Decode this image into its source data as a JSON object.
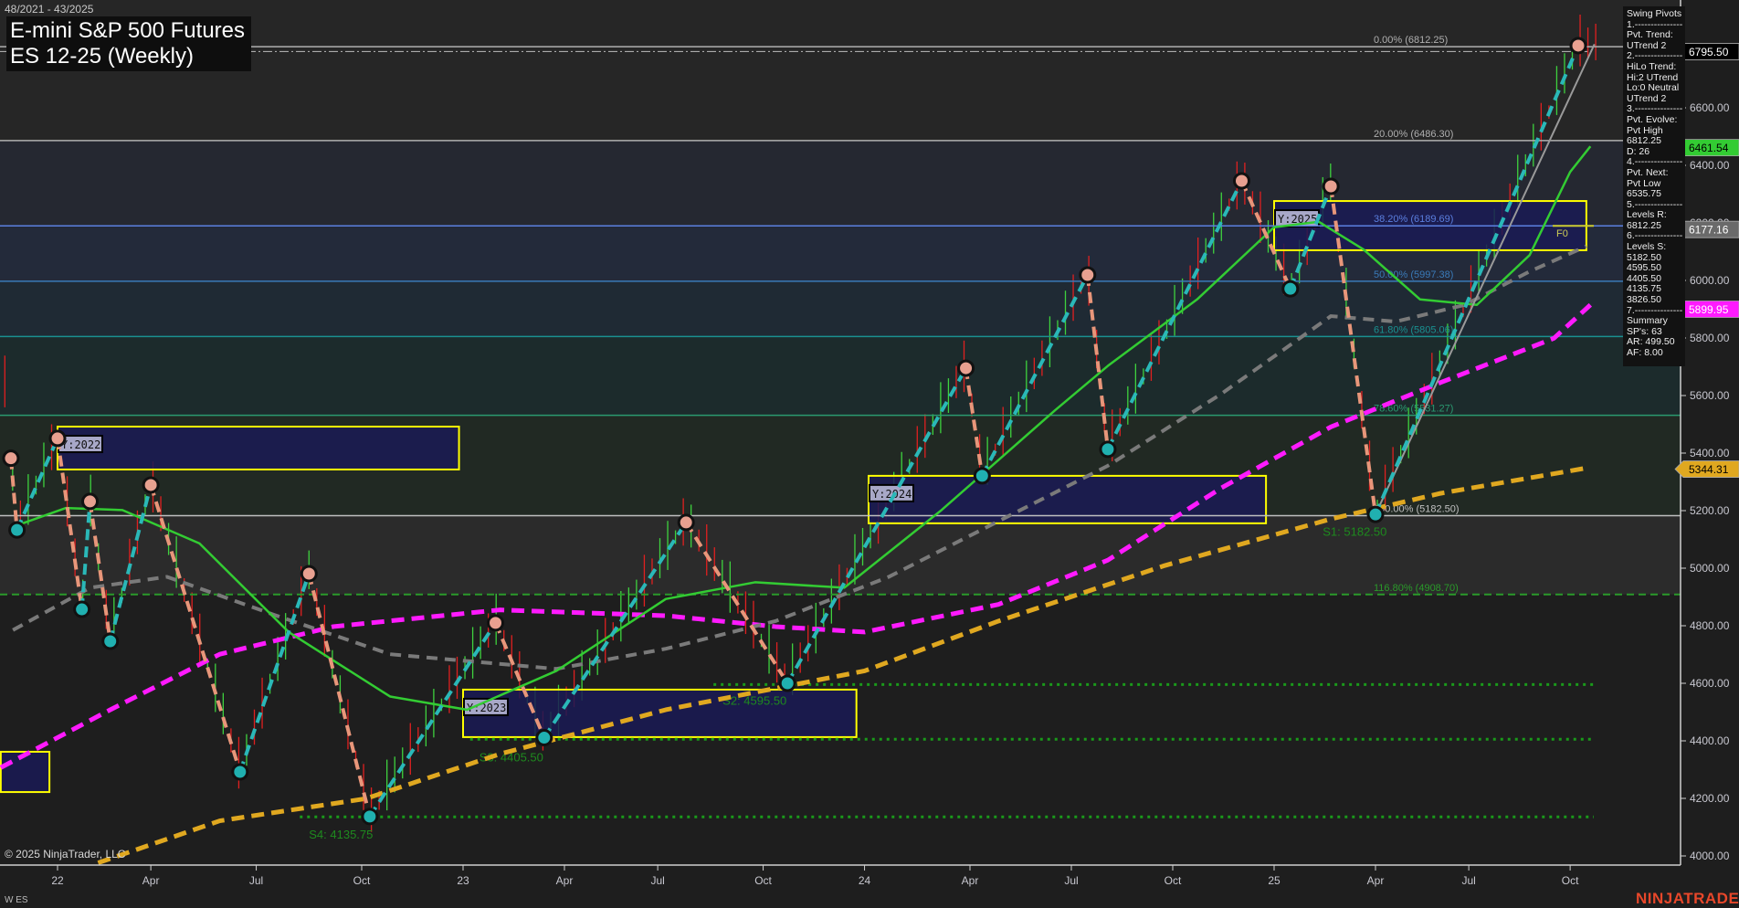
{
  "header": {
    "date_range": "48/2021 - 43/2025",
    "title": "E-mini S&P 500 Futures",
    "subtitle": "ES 12-25 (Weekly)"
  },
  "info_panel": {
    "lines": [
      "Swing Pivots",
      "1.---------------",
      "Pvt. Trend:",
      "UTrend 2",
      "2.---------------",
      "HiLo Trend:",
      "Hi:2 UTrend",
      "Lo:0 Neutral",
      "UTrend 2",
      "3.---------------",
      "Pvt. Evolve:",
      "Pvt High",
      "6812.25",
      "D: 26",
      "4.---------------",
      "Pvt. Next:",
      "Pvt Low",
      "6535.75",
      "5.---------------",
      "Levels R:",
      "6812.25",
      "6.---------------",
      "Levels S:",
      "5182.50",
      "4595.50",
      "4405.50",
      "4135.75",
      "3826.50",
      "7.---------------",
      "Summary",
      "SP's: 63",
      "AR: 499.50",
      "AF: 8.00"
    ]
  },
  "footer": {
    "copyright": "© 2025 NinjaTrader, LLC",
    "instrument_tag": "W ES",
    "brand": "NINJATRADER"
  },
  "colors": {
    "up_swing": "#2ab8b8",
    "down_swing": "#e8967a",
    "ma_green": "#33cc33",
    "ma_gray": "#7a7a7a",
    "ma_magenta": "#ff1aff",
    "ma_orange": "#e0a820",
    "zone_fill": "#1a1a55",
    "zone_border": "#ffff00",
    "brand": "#e8472a"
  },
  "chart_data": {
    "type": "line",
    "title": "E-mini S&P 500 Futures ES 12-25 (Weekly)",
    "xlabel": "",
    "ylabel": "",
    "ylim": [
      4000,
      6900
    ],
    "x_ticks": [
      {
        "label": "22",
        "x": 2022.0
      },
      {
        "label": "Apr",
        "x": 2022.23
      },
      {
        "label": "Jul",
        "x": 2022.49
      },
      {
        "label": "Oct",
        "x": 2022.75
      },
      {
        "label": "23",
        "x": 2023.0
      },
      {
        "label": "Apr",
        "x": 2023.25
      },
      {
        "label": "Jul",
        "x": 2023.48
      },
      {
        "label": "Oct",
        "x": 2023.74
      },
      {
        "label": "24",
        "x": 2023.99
      },
      {
        "label": "Apr",
        "x": 2024.25
      },
      {
        "label": "Jul",
        "x": 2024.5
      },
      {
        "label": "Oct",
        "x": 2024.75
      },
      {
        "label": "25",
        "x": 2025.0
      },
      {
        "label": "Apr",
        "x": 2025.25
      },
      {
        "label": "Jul",
        "x": 2025.48
      },
      {
        "label": "Oct",
        "x": 2025.73
      }
    ],
    "y_ticks": [
      "4000.00",
      "4200.00",
      "4400.00",
      "4600.00",
      "4800.00",
      "5000.00",
      "5200.00",
      "5400.00",
      "5600.00",
      "5800.00",
      "6000.00",
      "6200.00",
      "6400.00",
      "6600.00"
    ],
    "y_tick_values": [
      4000,
      4200,
      4400,
      4600,
      4800,
      5000,
      5200,
      5400,
      5600,
      5800,
      6000,
      6200,
      6400,
      6600
    ],
    "price_tags": [
      {
        "label": "6795.50",
        "value": 6795.5,
        "bg": "#000000",
        "fg": "#ffffff"
      },
      {
        "label": "6461.54",
        "value": 6461.54,
        "bg": "#33cc33",
        "fg": "#000000"
      },
      {
        "label": "6177.16",
        "value": 6177.16,
        "bg": "#6a6a6a",
        "fg": "#ffffff"
      },
      {
        "label": "5899.95",
        "value": 5899.95,
        "bg": "#ff1aff",
        "fg": "#ffffff"
      },
      {
        "label": "5344.31",
        "value": 5344.31,
        "bg": "#e0a820",
        "fg": "#000000"
      }
    ],
    "fib_levels": [
      {
        "label": "0.00% (6812.25)",
        "value": 6812.25,
        "color": "#b0b0b0"
      },
      {
        "label": "20.00% (6486.30)",
        "value": 6486.3,
        "color": "#b0b0b0"
      },
      {
        "label": "38.20% (6189.69)",
        "value": 6189.69,
        "color": "#5b7fe0"
      },
      {
        "label": "50.00% (5997.38)",
        "value": 5997.38,
        "color": "#3a7ab8"
      },
      {
        "label": "61.80% (5805.06)",
        "value": 5805.06,
        "color": "#1a9090"
      },
      {
        "label": "78.60% (5531.27)",
        "value": 5531.27,
        "color": "#2a9a70"
      },
      {
        "label": "100.00% (5182.50)",
        "value": 5182.5,
        "color": "#c0c0c0"
      },
      {
        "label": "116.80% (4908.70)",
        "value": 4908.7,
        "color": "#2a9a2a"
      }
    ],
    "support_levels": [
      {
        "label": "S1: 5182.50",
        "value": 5182.5,
        "label_x": 2025.12
      },
      {
        "label": "S2: 4595.50",
        "value": 4595.5,
        "label_x": 2023.64
      },
      {
        "label": "S3: 4405.50",
        "value": 4405.5,
        "label_x": 2023.04
      },
      {
        "label": "S4: 4135.75",
        "value": 4135.75,
        "label_x": 2022.62
      }
    ],
    "f0_label": "F0",
    "year_zones": [
      {
        "label": "",
        "x0": 2021.86,
        "x1": 2021.98,
        "top": 4362,
        "bottom": 4222
      },
      {
        "label": "Y:2022",
        "x0": 2022.0,
        "x1": 2022.99,
        "top": 5492,
        "bottom": 5343
      },
      {
        "label": "Y:2023",
        "x0": 2023.0,
        "x1": 2023.97,
        "top": 4578,
        "bottom": 4413
      },
      {
        "label": "Y:2024",
        "x0": 2024.0,
        "x1": 2024.98,
        "top": 5321,
        "bottom": 5156
      },
      {
        "label": "Y:2025",
        "x0": 2025.0,
        "x1": 2025.77,
        "top": 6276,
        "bottom": 6105
      }
    ],
    "swing_pivots": [
      [
        2021.885,
        5382
      ],
      [
        2021.9,
        5133
      ],
      [
        2022.0,
        5451
      ],
      [
        2022.06,
        4857
      ],
      [
        2022.08,
        5232
      ],
      [
        2022.13,
        4746
      ],
      [
        2022.23,
        5289
      ],
      [
        2022.45,
        4292
      ],
      [
        2022.62,
        4981
      ],
      [
        2022.77,
        4137
      ],
      [
        2023.08,
        4810
      ],
      [
        2023.2,
        4411
      ],
      [
        2023.55,
        5159
      ],
      [
        2023.8,
        4600
      ],
      [
        2024.24,
        5695
      ],
      [
        2024.28,
        5321
      ],
      [
        2024.54,
        6019
      ],
      [
        2024.59,
        5413
      ],
      [
        2024.92,
        6346
      ],
      [
        2025.04,
        5971
      ],
      [
        2025.14,
        6327
      ],
      [
        2025.25,
        5187
      ],
      [
        2025.75,
        6816
      ]
    ],
    "series": [
      {
        "name": "ma_magenta",
        "style": "dashed",
        "points": [
          [
            2021.86,
            4307
          ],
          [
            2022.13,
            4508
          ],
          [
            2022.4,
            4701
          ],
          [
            2022.68,
            4797
          ],
          [
            2023.09,
            4855
          ],
          [
            2023.5,
            4835
          ],
          [
            2023.77,
            4797
          ],
          [
            2023.99,
            4778
          ],
          [
            2024.32,
            4874
          ],
          [
            2024.59,
            5028
          ],
          [
            2024.87,
            5279
          ],
          [
            2025.14,
            5491
          ],
          [
            2025.41,
            5645
          ],
          [
            2025.69,
            5799
          ],
          [
            2025.78,
            5915
          ]
        ]
      },
      {
        "name": "ma_orange",
        "style": "dashed",
        "points": [
          [
            2022.1,
            3976
          ],
          [
            2022.4,
            4122
          ],
          [
            2022.76,
            4199
          ],
          [
            2023.09,
            4354
          ],
          [
            2023.5,
            4508
          ],
          [
            2023.99,
            4643
          ],
          [
            2024.32,
            4816
          ],
          [
            2024.73,
            5009
          ],
          [
            2025.14,
            5171
          ],
          [
            2025.41,
            5260
          ],
          [
            2025.77,
            5348
          ]
        ]
      },
      {
        "name": "ma_gray",
        "style": "dashed",
        "points": [
          [
            2021.89,
            4785
          ],
          [
            2022.08,
            4932
          ],
          [
            2022.27,
            4970
          ],
          [
            2022.54,
            4835
          ],
          [
            2022.82,
            4701
          ],
          [
            2023.23,
            4650
          ],
          [
            2023.5,
            4720
          ],
          [
            2023.77,
            4816
          ],
          [
            2024.05,
            4970
          ],
          [
            2024.32,
            5163
          ],
          [
            2024.59,
            5356
          ],
          [
            2024.87,
            5606
          ],
          [
            2025.14,
            5876
          ],
          [
            2025.3,
            5857
          ],
          [
            2025.47,
            5915
          ],
          [
            2025.63,
            6031
          ],
          [
            2025.77,
            6119
          ]
        ]
      },
      {
        "name": "ma_green",
        "style": "solid",
        "points": [
          [
            2021.89,
            5144
          ],
          [
            2022.02,
            5209
          ],
          [
            2022.16,
            5202
          ],
          [
            2022.35,
            5086
          ],
          [
            2022.57,
            4778
          ],
          [
            2022.82,
            4554
          ],
          [
            2023.01,
            4508
          ],
          [
            2023.23,
            4643
          ],
          [
            2023.5,
            4893
          ],
          [
            2023.72,
            4951
          ],
          [
            2023.94,
            4932
          ],
          [
            2024.18,
            5202
          ],
          [
            2024.46,
            5549
          ],
          [
            2024.59,
            5703
          ],
          [
            2024.81,
            5934
          ],
          [
            2025.0,
            6185
          ],
          [
            2025.11,
            6204
          ],
          [
            2025.22,
            6108
          ],
          [
            2025.36,
            5934
          ],
          [
            2025.5,
            5915
          ],
          [
            2025.63,
            6088
          ],
          [
            2025.73,
            6377
          ],
          [
            2025.78,
            6466
          ]
        ]
      },
      {
        "name": "trend_line",
        "style": "solid",
        "points": [
          [
            2025.25,
            5187
          ],
          [
            2025.79,
            6821
          ]
        ]
      }
    ]
  }
}
